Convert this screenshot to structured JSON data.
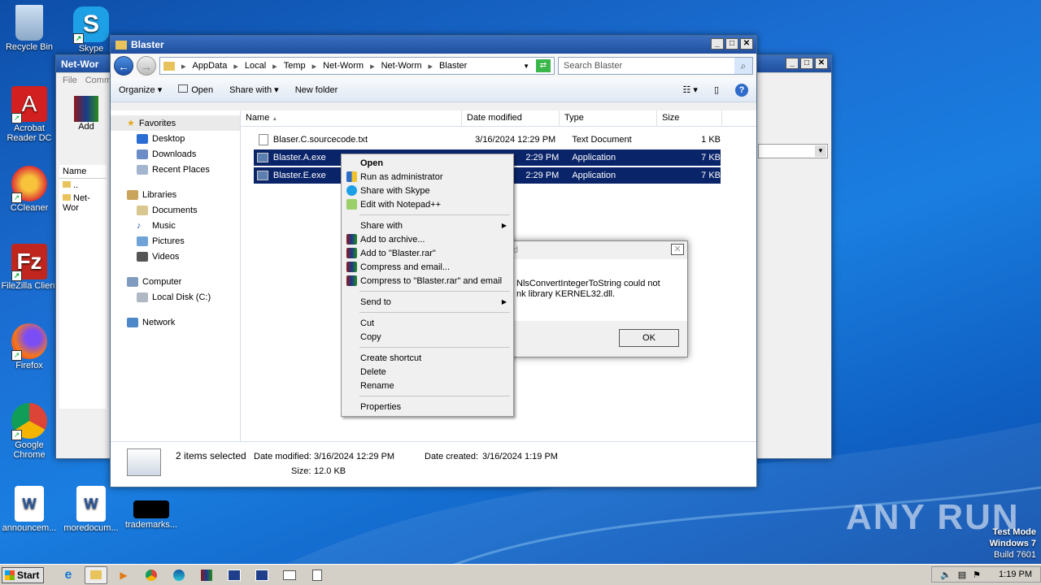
{
  "desktop": {
    "icons": [
      {
        "label": "Recycle Bin",
        "icon": "recycle-bin-icon"
      },
      {
        "label": "Skype",
        "icon": "skype-icon"
      },
      {
        "label": "Acrobat Reader DC",
        "icon": "acrobat-icon"
      },
      {
        "label": "CCleaner",
        "icon": "ccleaner-icon"
      },
      {
        "label": "FileZilla Client",
        "icon": "filezilla-icon"
      },
      {
        "label": "Firefox",
        "icon": "firefox-icon"
      },
      {
        "label": "Google Chrome",
        "icon": "chrome-icon"
      },
      {
        "label": "announcem...",
        "icon": "word-doc-icon"
      },
      {
        "label": "moredocum...",
        "icon": "word-doc-icon"
      },
      {
        "label": "trademarks...",
        "icon": "black-file-icon"
      }
    ]
  },
  "backwin": {
    "title": "Net-Wor",
    "menu": [
      "File",
      "Comm"
    ],
    "add_label": "Add",
    "col_name": "Name",
    "rows": [
      "..",
      "Net-Wor"
    ]
  },
  "explorer": {
    "title": "Blaster",
    "path": [
      "AppData",
      "Local",
      "Temp",
      "Net-Worm",
      "Net-Worm",
      "Blaster"
    ],
    "search_placeholder": "Search Blaster",
    "toolbar": {
      "organize": "Organize",
      "open": "Open",
      "share": "Share with",
      "newfolder": "New folder"
    },
    "nav": {
      "favorites": "Favorites",
      "desktop": "Desktop",
      "downloads": "Downloads",
      "recent": "Recent Places",
      "libraries": "Libraries",
      "documents": "Documents",
      "music": "Music",
      "pictures": "Pictures",
      "videos": "Videos",
      "computer": "Computer",
      "localdisk": "Local Disk (C:)",
      "network": "Network"
    },
    "columns": {
      "name": "Name",
      "date": "Date modified",
      "type": "Type",
      "size": "Size"
    },
    "files": [
      {
        "name": "Blaser.C.sourcecode.txt",
        "date": "3/16/2024 12:29 PM",
        "type": "Text Document",
        "size": "1 KB"
      },
      {
        "name": "Blaster.A.exe",
        "date": "2:29 PM",
        "type": "Application",
        "size": "7 KB"
      },
      {
        "name": "Blaster.E.exe",
        "date": "2:29 PM",
        "type": "Application",
        "size": "7 KB"
      }
    ],
    "details": {
      "count": "2 items selected",
      "modified_label": "Date modified:",
      "modified": "3/16/2024 12:29 PM",
      "created_label": "Date created:",
      "created": "3/16/2024 1:19 PM",
      "size_label": "Size:",
      "size": "12.0 KB"
    }
  },
  "dialog": {
    "title_fragment": "d",
    "line1": "NlsConvertIntegerToString could not",
    "line2": "nk library KERNEL32.dll.",
    "ok": "OK"
  },
  "context_menu": {
    "open": "Open",
    "runadmin": "Run as administrator",
    "skype": "Share with Skype",
    "notepad": "Edit with Notepad++",
    "sharewith": "Share with",
    "archive": "Add to archive...",
    "addrar": "Add to \"Blaster.rar\"",
    "compress": "Compress and email...",
    "compressrar": "Compress to \"Blaster.rar\" and email",
    "sendto": "Send to",
    "cut": "Cut",
    "copy": "Copy",
    "shortcut": "Create shortcut",
    "delete": "Delete",
    "rename": "Rename",
    "properties": "Properties"
  },
  "taskbar": {
    "start": "Start",
    "clock": "1:19 PM"
  },
  "watermark": {
    "brand": "ANY RUN",
    "mode": "Test Mode",
    "os": "Windows 7",
    "build": "Build 7601"
  },
  "colors": {
    "selection": "#0a246a",
    "titlebar": "#1f4f9e",
    "desktop": "#1a7ee0"
  }
}
